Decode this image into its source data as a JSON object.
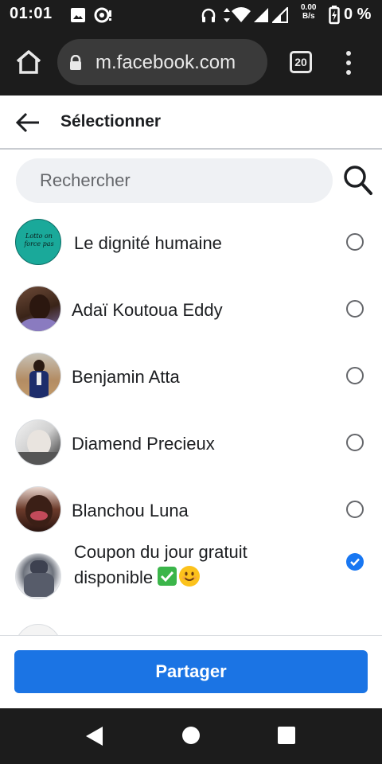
{
  "status_bar": {
    "time": "01:01",
    "net_speed_value": "0.00",
    "net_speed_unit": "B/s",
    "battery_percent": "0 %"
  },
  "browser": {
    "url": "m.facebook.com",
    "tab_count": "20"
  },
  "header": {
    "title": "Sélectionner"
  },
  "search": {
    "placeholder": "Rechercher"
  },
  "contacts": [
    {
      "name": "Le dignité humaine",
      "avatar_text_line1": "Lotto on",
      "avatar_text_line2": "force pas",
      "selected": false
    },
    {
      "name": "Adaï Koutoua Eddy",
      "selected": false
    },
    {
      "name": "Benjamin Atta",
      "selected": false
    },
    {
      "name": "Diamend Precieux",
      "selected": false
    },
    {
      "name": "Blanchou Luna",
      "selected": false
    },
    {
      "name_line1": "Coupon du jour gratuit",
      "name_line2": "disponible",
      "selected": true
    }
  ],
  "footer": {
    "share_label": "Partager"
  },
  "colors": {
    "accent": "#1b74e4",
    "dark_chrome": "#1c1c1c"
  },
  "icons": [
    "home-icon",
    "lock-icon",
    "tabs-icon",
    "overflow-menu-icon",
    "back-arrow-icon",
    "search-icon",
    "radio-icon",
    "check-icon",
    "nav-back-icon",
    "nav-home-icon",
    "nav-recents-icon"
  ]
}
